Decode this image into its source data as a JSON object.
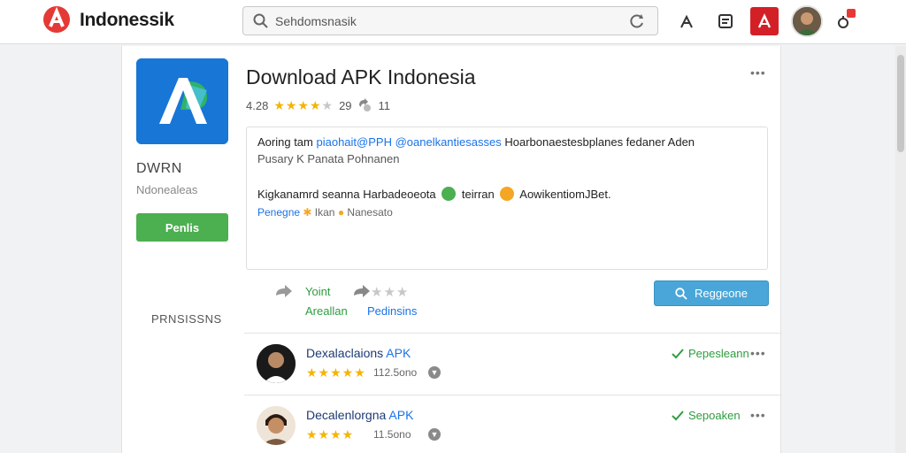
{
  "header": {
    "brand": "Indonessik",
    "search_value": "Sehdomsnasik"
  },
  "app": {
    "title": "Download APK Indonesia",
    "rating_value": "4.28",
    "rating_stars": 4,
    "version": "29",
    "size": "11",
    "developer": "DWRN",
    "developer_sub": "Ndonealeas",
    "install_label": "Penlis",
    "permissions_label": "PRNSISSNS"
  },
  "description": {
    "line1_prefix": "Aoring tam",
    "line1_link": "piaohait@PPH @oanelkantiesasses",
    "line1_suffix": "Hoarbonaestesbplanes fedaner Aden",
    "line2": "Pusary  K  Panata    Pohnanen",
    "line3_a": "Kigkanamrd seanna Harbadeoeota",
    "line3_b": "teirran",
    "line3_c": "Aowikentiom",
    "line3_d": "JBet.",
    "line4_a": "Penegne",
    "line4_b": "Ikan",
    "line4_c": "Nanesato"
  },
  "actions": {
    "act1_top": "Yoint",
    "act1_bottom": "Areallan",
    "act2_bottom": "Pedinsins",
    "act2_stars": 0,
    "share_label": "Reggeone"
  },
  "reviews": [
    {
      "name": "Dexalaclaions",
      "apk": "APK",
      "stars": 5,
      "size": "112.5ono",
      "status": "Pepesleann"
    },
    {
      "name": "Decalenlorgna",
      "apk": "APK",
      "stars": 4,
      "size": "11.5ono",
      "status": "Sepoaken"
    }
  ],
  "colors": {
    "accent_green": "#4caf50",
    "accent_blue": "#4aa6d8",
    "brand_red": "#d32027",
    "star": "#f5b400"
  },
  "icons": {
    "logo": "app-logo-icon",
    "search": "search-icon",
    "refresh": "refresh-icon",
    "share": "share-icon",
    "store": "store-icon",
    "pdf": "adobe-icon",
    "notify": "notification-icon"
  }
}
